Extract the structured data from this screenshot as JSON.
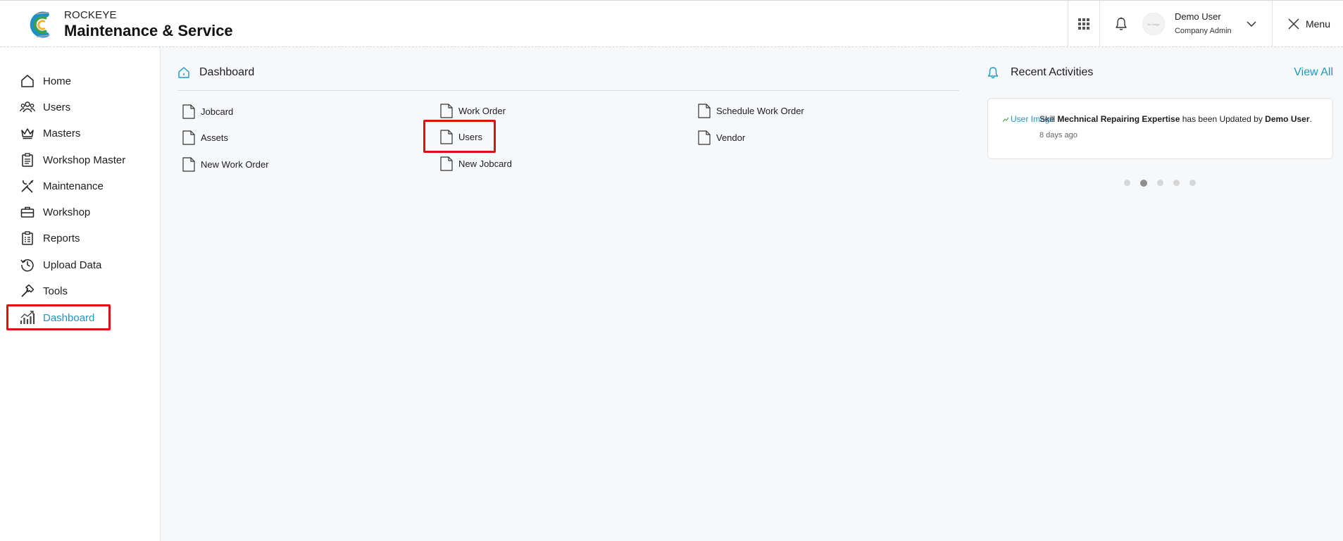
{
  "brand": {
    "company": "ROCKEYE",
    "product": "Maintenance & Service"
  },
  "header": {
    "apps_icon": "grid-icon",
    "notification_icon": "bell-icon",
    "avatar_text": "No Image",
    "user_name": "Demo User",
    "user_role": "Company Admin",
    "menu_label": "Menu"
  },
  "sidebar": {
    "items": [
      {
        "label": "Home",
        "icon": "home-icon"
      },
      {
        "label": "Users",
        "icon": "users-icon"
      },
      {
        "label": "Masters",
        "icon": "crown-icon"
      },
      {
        "label": "Workshop Master",
        "icon": "clipboard-icon"
      },
      {
        "label": "Maintenance",
        "icon": "tools-icon"
      },
      {
        "label": "Workshop",
        "icon": "briefcase-icon"
      },
      {
        "label": "Reports",
        "icon": "report-icon"
      },
      {
        "label": "Upload Data",
        "icon": "history-icon"
      },
      {
        "label": "Tools",
        "icon": "hammer-icon"
      },
      {
        "label": "Dashboard",
        "icon": "chart-icon"
      }
    ],
    "active": "Dashboard"
  },
  "main": {
    "title": "Dashboard",
    "links": [
      {
        "label": "Jobcard"
      },
      {
        "label": "Work Order"
      },
      {
        "label": "Schedule Work Order"
      },
      {
        "label": "Assets"
      },
      {
        "label": "Users"
      },
      {
        "label": "Vendor"
      },
      {
        "label": "New Work Order"
      },
      {
        "label": "New Jobcard"
      }
    ]
  },
  "recent": {
    "title": "Recent Activities",
    "view_all": "View All",
    "activity": {
      "image_alt": "User Image",
      "prefix": "Skill ",
      "subject": "Mechnical Repairing Expertise",
      "middle": " has been Updated by ",
      "actor": "Demo User",
      "suffix": ".",
      "time": "8 days ago"
    },
    "dots_total": 5,
    "dot_active": 2
  },
  "colors": {
    "accent": "#2196c4",
    "highlight": "#e01010"
  }
}
